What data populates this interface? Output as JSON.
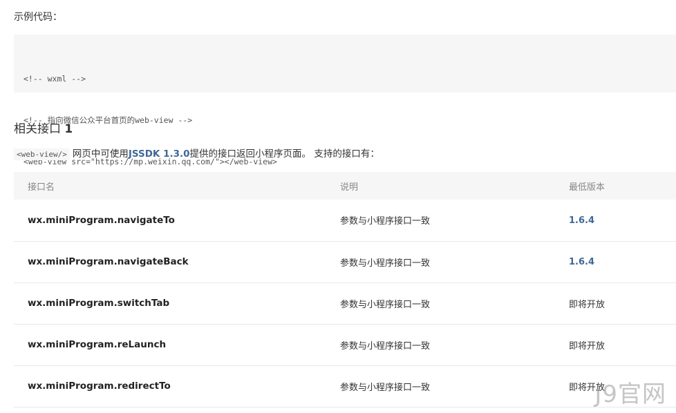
{
  "example": {
    "label": "示例代码：",
    "code_lines": [
      "<!-- wxml -->",
      "<!-- 指向微信公众平台首页的web-view -->",
      "<web-view src=\"https://mp.weixin.qq.com/\"></web-view>"
    ]
  },
  "section": {
    "title": "相关接口",
    "title_num": "1",
    "desc_code": "<web-view/>",
    "desc_pre": "网页中可使用",
    "desc_link": "JSSDK 1.3.0",
    "desc_post": "提供的接口返回小程序页面。 支持的接口有："
  },
  "table": {
    "headers": [
      "接口名",
      "说明",
      "最低版本"
    ],
    "rows": [
      {
        "name": "wx.miniProgram.navigateTo",
        "desc": "参数与小程序接口一致",
        "version": "1.6.4",
        "version_is_link": true
      },
      {
        "name": "wx.miniProgram.navigateBack",
        "desc": "参数与小程序接口一致",
        "version": "1.6.4",
        "version_is_link": true
      },
      {
        "name": "wx.miniProgram.switchTab",
        "desc": "参数与小程序接口一致",
        "version": "即将开放",
        "version_is_link": false
      },
      {
        "name": "wx.miniProgram.reLaunch",
        "desc": "参数与小程序接口一致",
        "version": "即将开放",
        "version_is_link": false
      },
      {
        "name": "wx.miniProgram.redirectTo",
        "desc": "参数与小程序接口一致",
        "version": "即将开放",
        "version_is_link": false
      }
    ]
  },
  "watermark": "J9官网",
  "colors": {
    "link": "#3f6796",
    "code_bg": "#f6f6f6",
    "header_bg": "#f6f6f7"
  }
}
